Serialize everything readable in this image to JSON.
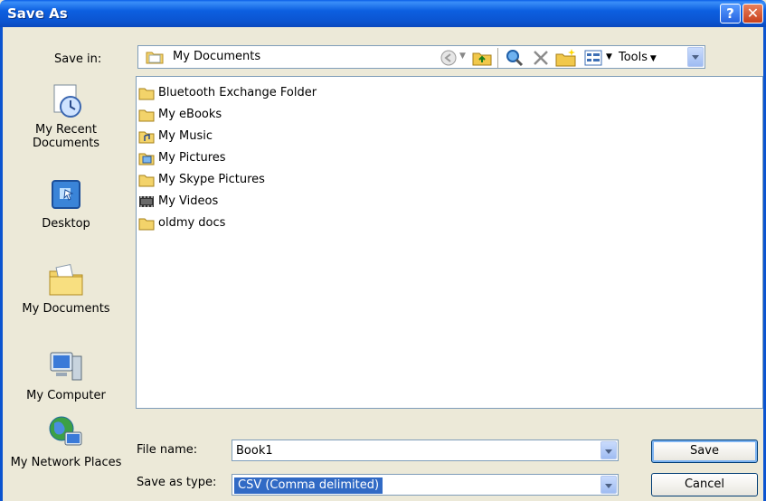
{
  "window": {
    "title": "Save As"
  },
  "title_buttons": {
    "help": "?",
    "close": "✕"
  },
  "save_in": {
    "label": "Save in:",
    "value": "My Documents"
  },
  "toolbar": {
    "tools_label": "Tools"
  },
  "places": [
    {
      "label": "My Recent Documents",
      "icon": "recent-documents-icon"
    },
    {
      "label": "Desktop",
      "icon": "desktop-icon"
    },
    {
      "label": "My Documents",
      "icon": "my-documents-icon"
    },
    {
      "label": "My Computer",
      "icon": "my-computer-icon"
    },
    {
      "label": "My Network Places",
      "icon": "network-places-icon"
    }
  ],
  "files": [
    {
      "name": "Bluetooth Exchange Folder",
      "icon": "folder-icon"
    },
    {
      "name": "My eBooks",
      "icon": "folder-icon"
    },
    {
      "name": "My Music",
      "icon": "music-folder-icon"
    },
    {
      "name": "My Pictures",
      "icon": "pictures-folder-icon"
    },
    {
      "name": "My Skype Pictures",
      "icon": "folder-icon"
    },
    {
      "name": "My Videos",
      "icon": "videos-folder-icon"
    },
    {
      "name": "oldmy docs",
      "icon": "folder-icon"
    }
  ],
  "file_name": {
    "label": "File name:",
    "value": "Book1"
  },
  "save_as_type": {
    "label": "Save as type:",
    "value": "CSV (Comma delimited)"
  },
  "buttons": {
    "save": "Save",
    "cancel": "Cancel"
  },
  "colors": {
    "titlebar": "#0b54d0",
    "selection": "#316ac5",
    "dialog_bg": "#ece9d8"
  }
}
